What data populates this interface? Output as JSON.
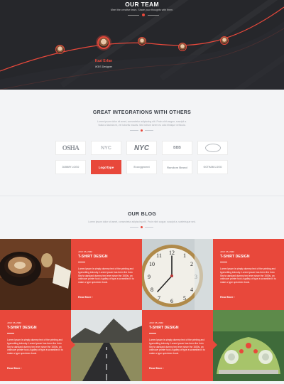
{
  "team": {
    "title": "OUR TEAM",
    "subtitle": "Meet the creative team. Share your thoughts with them.",
    "member": {
      "name": "Kazi Erfan",
      "role": "W3IS Designer"
    }
  },
  "integrations": {
    "title": "GREAT INTEGRATIONS WITH OTHERS",
    "subtitle_line1": "Lorem ipsum dolor sit amet, consectetur adipiscing elit. Proin nibh augue, suscipit a.",
    "subtitle_line2": "Nulla ut lacinia mi, vel lobortis mauris. Sed rutrum lorem eu odio tristique vehicula.",
    "logos": [
      {
        "label": "OSHA"
      },
      {
        "label": "NYC"
      },
      {
        "label": "NYC"
      },
      {
        "label": "BBB"
      },
      {
        "label": "seal"
      },
      {
        "label": "DUMMY LOGO"
      },
      {
        "label": "LogoType"
      },
      {
        "label": "Ecoxygenent"
      },
      {
        "label": "Random Brand"
      },
      {
        "label": "GOTHAM LOGO"
      }
    ]
  },
  "blog": {
    "title": "OUR BLOG",
    "subtitle": "Lorem ipsum dolor sit amet, consectetur adipiscing elit. Proin nibh augue, suscipit a, scelerisque sed.",
    "posts": [
      {
        "date": "JULY 25, 2022",
        "title": "T-SHIRT DESIGN",
        "body": "Lorem Ipsum is simply dummy text of the printing and typesetting industry. Lorem Ipsum has been the Indu Stry's standard dummy text ever since the 1500s, an unknown printer took a galley of type a scrambled it to make a type specimen book.",
        "more": "Read More"
      },
      {
        "date": "JULY 25, 2022",
        "title": "T-SHIRT DESIGN",
        "body": "Lorem Ipsum is simply dummy text of the printing and typesetting industry. Lorem Ipsum has been the Indu Stry's standard dummy text ever since the 1500s, an unknown printer took a galley of type a scrambled it to make a type specimen book.",
        "more": "Read More"
      },
      {
        "date": "JULY 25, 2022",
        "title": "T-SHIRT DESIGN",
        "body": "Lorem Ipsum is simply dummy text of the printing and typesetting industry. Lorem Ipsum has been the Indu Stry's standard dummy text ever since the 1500s, an unknown printer took a galley of type a scrambled it to make a type specimen book.",
        "more": "Read More"
      },
      {
        "date": "JULY 25, 2022",
        "title": "T-SHIRT DESIGN",
        "body": "Lorem Ipsum is simply dummy text of the printing and typesetting industry. Lorem Ipsum has been the Indu Stry's standard dummy text ever since the 1500s, an unknown printer took a galley of type a scrambled it to make a type specimen book.",
        "more": "Read More"
      }
    ]
  },
  "colors": {
    "accent": "#e8483b",
    "dark": "#26272b",
    "light": "#f3f4f6"
  }
}
